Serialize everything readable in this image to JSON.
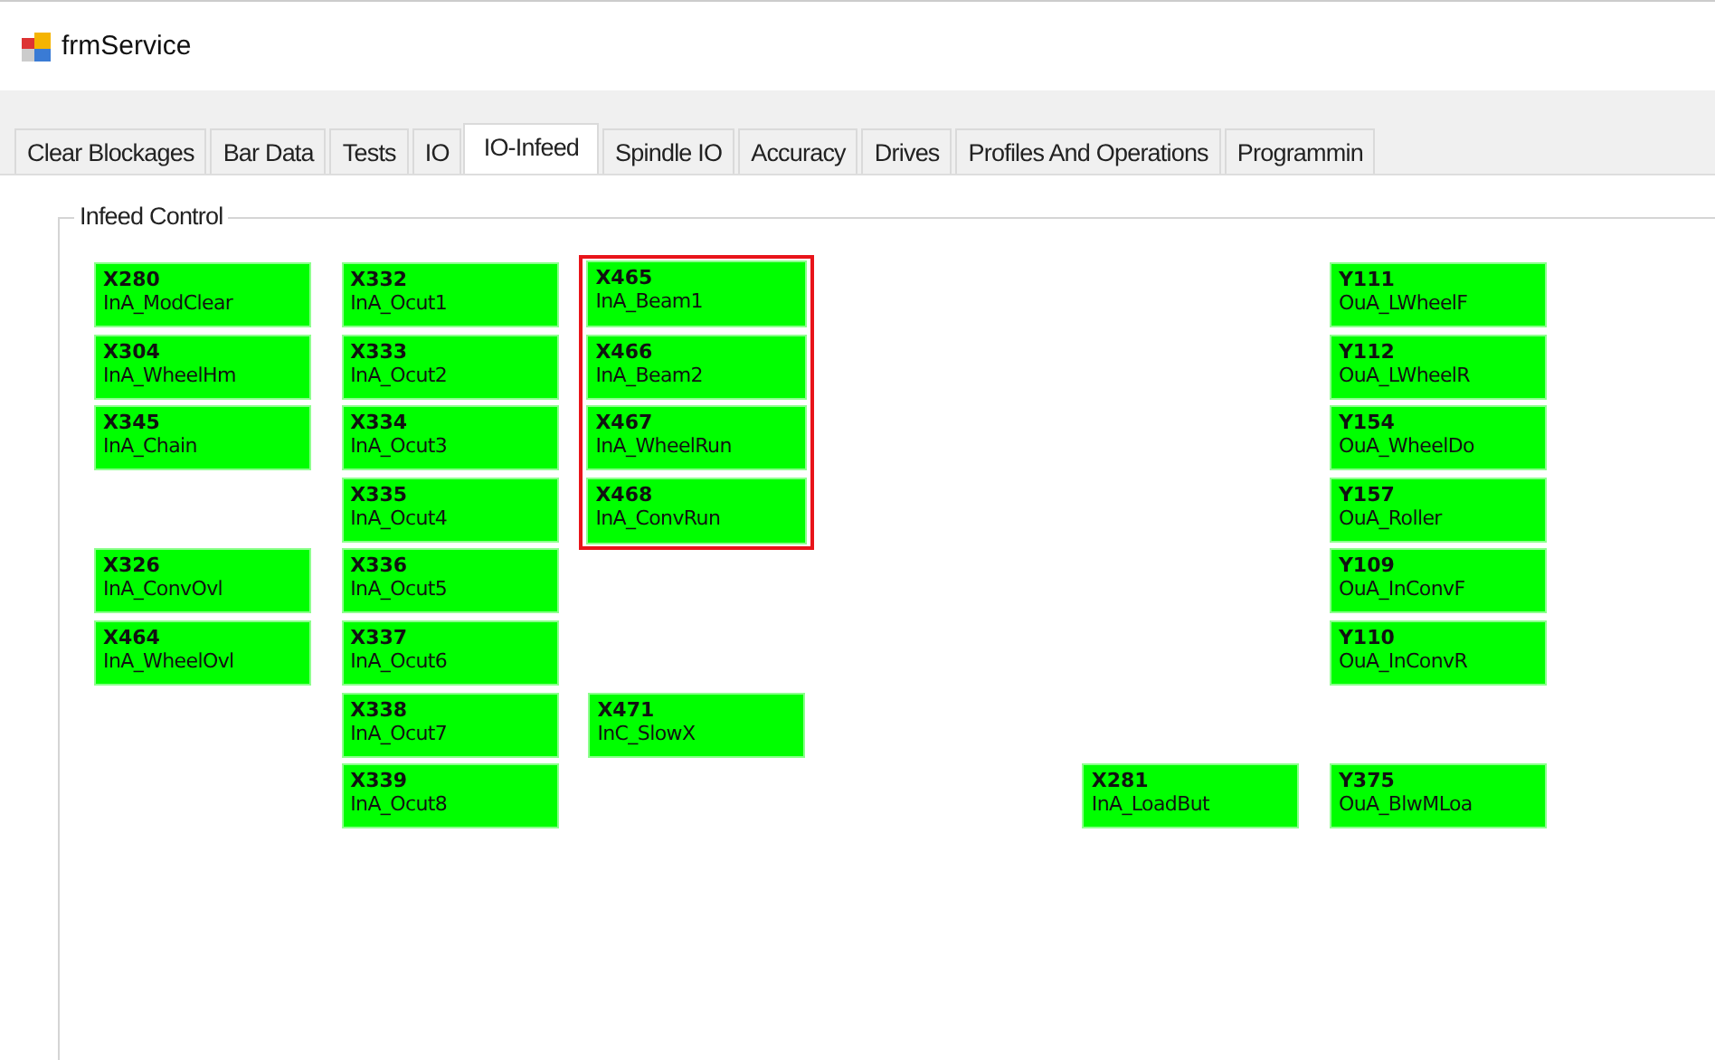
{
  "window": {
    "title": "frmService"
  },
  "tabs": [
    {
      "label": "Clear Blockages",
      "selected": false
    },
    {
      "label": "Bar Data",
      "selected": false
    },
    {
      "label": "Tests",
      "selected": false
    },
    {
      "label": "IO",
      "selected": false
    },
    {
      "label": "IO-Infeed",
      "selected": true
    },
    {
      "label": "Spindle IO",
      "selected": false
    },
    {
      "label": "Accuracy",
      "selected": false
    },
    {
      "label": "Drives",
      "selected": false
    },
    {
      "label": "Profiles And Operations",
      "selected": false
    },
    {
      "label": "Programmin",
      "selected": false
    }
  ],
  "infeed_control": {
    "title": "Infeed Control",
    "signals": [
      {
        "address": "X280",
        "name": "InA_ModClear",
        "highlighted": false
      },
      {
        "address": "X304",
        "name": "InA_WheelHm",
        "highlighted": false
      },
      {
        "address": "X345",
        "name": "InA_Chain",
        "highlighted": false
      },
      {
        "address": "X326",
        "name": "InA_ConvOvl",
        "highlighted": false
      },
      {
        "address": "X464",
        "name": "InA_WheelOvl",
        "highlighted": false
      },
      {
        "address": "X332",
        "name": "InA_Ocut1",
        "highlighted": false
      },
      {
        "address": "X333",
        "name": "InA_Ocut2",
        "highlighted": false
      },
      {
        "address": "X334",
        "name": "InA_Ocut3",
        "highlighted": false
      },
      {
        "address": "X335",
        "name": "InA_Ocut4",
        "highlighted": false
      },
      {
        "address": "X336",
        "name": "InA_Ocut5",
        "highlighted": false
      },
      {
        "address": "X337",
        "name": "InA_Ocut6",
        "highlighted": false
      },
      {
        "address": "X338",
        "name": "InA_Ocut7",
        "highlighted": false
      },
      {
        "address": "X339",
        "name": "InA_Ocut8",
        "highlighted": false
      },
      {
        "address": "X465",
        "name": "InA_Beam1",
        "highlighted": true
      },
      {
        "address": "X466",
        "name": "InA_Beam2",
        "highlighted": true
      },
      {
        "address": "X467",
        "name": "InA_WheelRun",
        "highlighted": true
      },
      {
        "address": "X468",
        "name": "InA_ConvRun",
        "highlighted": true
      },
      {
        "address": "X471",
        "name": "InC_SlowX",
        "highlighted": false
      },
      {
        "address": "X281",
        "name": "InA_LoadBut",
        "highlighted": false
      },
      {
        "address": "Y111",
        "name": "OuA_LWheelF",
        "highlighted": false
      },
      {
        "address": "Y112",
        "name": "OuA_LWheelR",
        "highlighted": false
      },
      {
        "address": "Y154",
        "name": "OuA_WheelDo",
        "highlighted": false
      },
      {
        "address": "Y157",
        "name": "OuA_Roller",
        "highlighted": false
      },
      {
        "address": "Y109",
        "name": "OuA_InConvF",
        "highlighted": false
      },
      {
        "address": "Y110",
        "name": "OuA_InConvR",
        "highlighted": false
      },
      {
        "address": "Y375",
        "name": "OuA_BlwMLoa",
        "highlighted": false
      }
    ]
  }
}
